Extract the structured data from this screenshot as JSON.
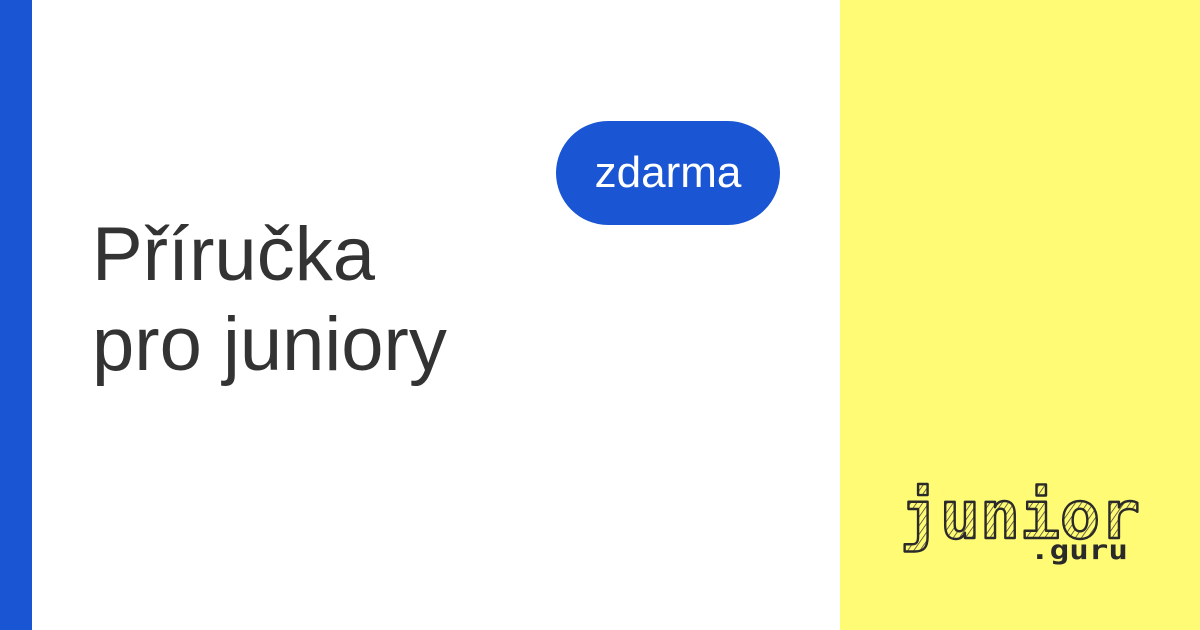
{
  "colors": {
    "accent_blue": "#1a56d3",
    "panel_yellow": "#fffb74",
    "text_dark": "#333333",
    "background": "#ffffff"
  },
  "badge": {
    "label": "zdarma"
  },
  "title": {
    "line1": "Příručka",
    "line2": "pro juniory"
  },
  "logo": {
    "word": "junior",
    "suffix": ".guru"
  }
}
